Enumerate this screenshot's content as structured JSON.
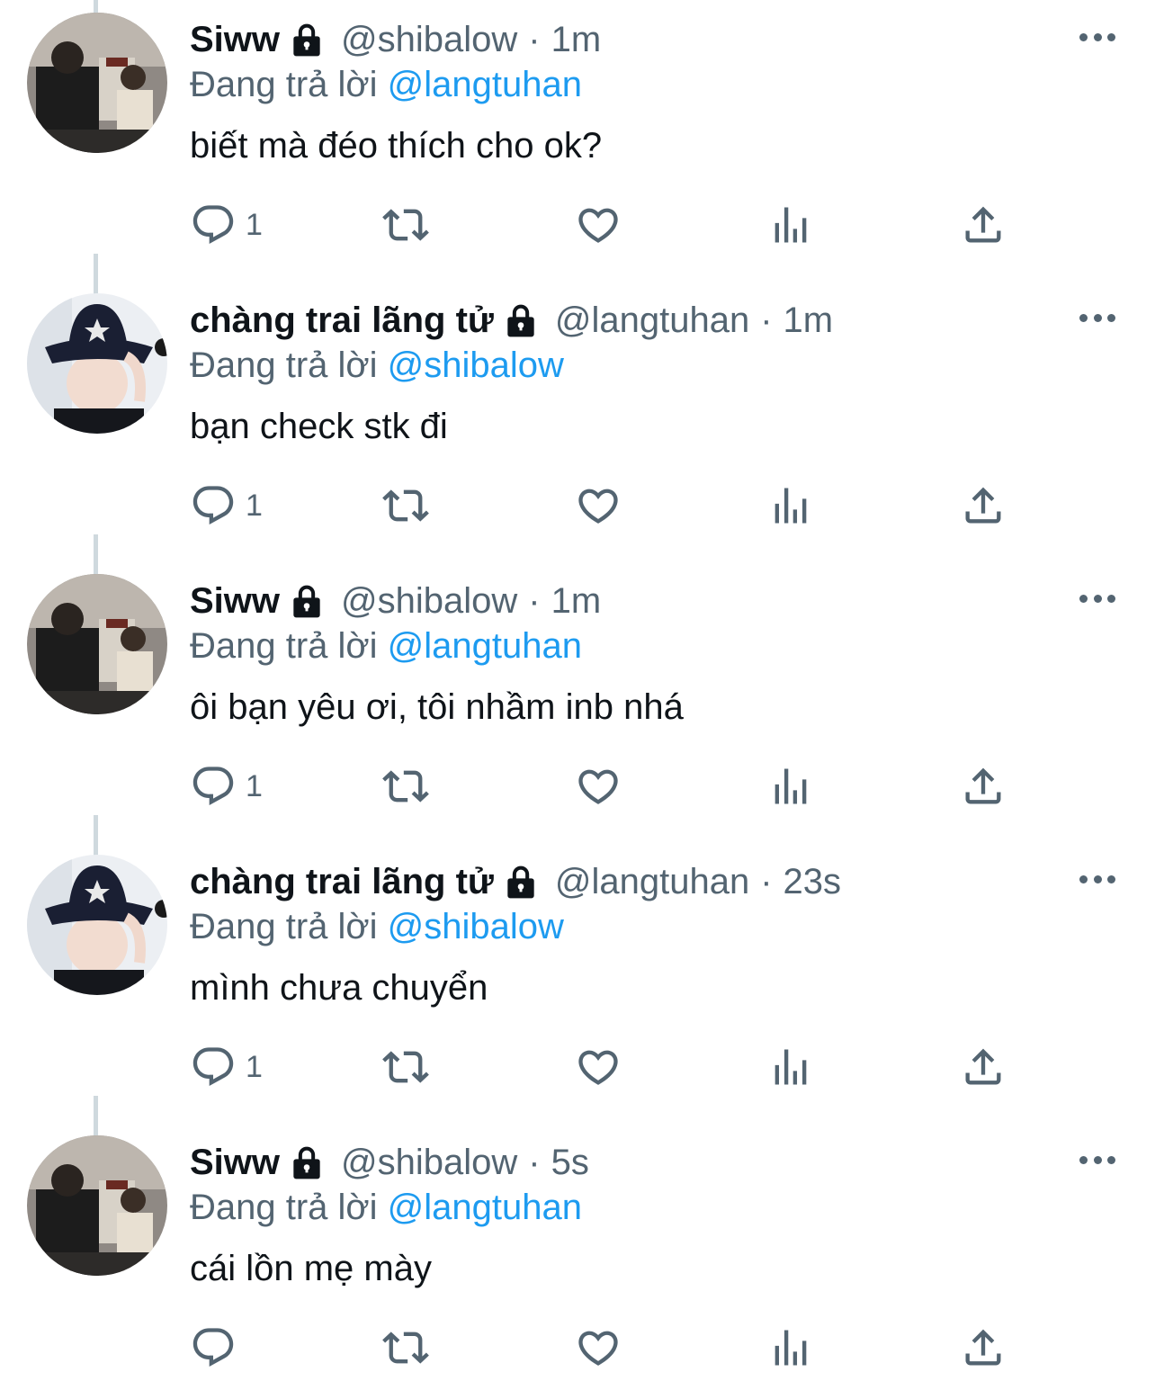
{
  "colors": {
    "text": "#0f1419",
    "secondary": "#536471",
    "accent": "#1d9bf0",
    "thread_line": "#cfd9de"
  },
  "tweets": [
    {
      "display_name": "Siww",
      "handle": "@shibalow",
      "separator": "·",
      "time": "1m",
      "reply_prefix": "Đang trả lời",
      "reply_to": "@langtuhan",
      "text": "biết mà đéo thích cho ok?",
      "reply_count": "1",
      "avatar": "siww-avatar",
      "locked": true
    },
    {
      "display_name": "chàng trai lãng tử",
      "handle": "@langtuhan",
      "separator": "·",
      "time": "1m",
      "reply_prefix": "Đang trả lời",
      "reply_to": "@shibalow",
      "text": "bạn check stk đi",
      "reply_count": "1",
      "avatar": "langtuhan-avatar",
      "locked": true
    },
    {
      "display_name": "Siww",
      "handle": "@shibalow",
      "separator": "·",
      "time": "1m",
      "reply_prefix": "Đang trả lời",
      "reply_to": "@langtuhan",
      "text": "ôi bạn yêu ơi, tôi nhầm inb nhá",
      "reply_count": "1",
      "avatar": "siww-avatar",
      "locked": true
    },
    {
      "display_name": "chàng trai lãng tử",
      "handle": "@langtuhan",
      "separator": "·",
      "time": "23s",
      "reply_prefix": "Đang trả lời",
      "reply_to": "@shibalow",
      "text": "mình chưa chuyển",
      "reply_count": "1",
      "avatar": "langtuhan-avatar",
      "locked": true
    },
    {
      "display_name": "Siww",
      "handle": "@shibalow",
      "separator": "·",
      "time": "5s",
      "reply_prefix": "Đang trả lời",
      "reply_to": "@langtuhan",
      "text": "cái lồn mẹ mày",
      "reply_count": "",
      "avatar": "siww-avatar",
      "locked": true
    }
  ],
  "icons": {
    "lock": "lock-icon",
    "more": "more-icon",
    "reply": "reply-icon",
    "retweet": "retweet-icon",
    "like": "heart-icon",
    "views": "analytics-icon",
    "share": "share-icon"
  }
}
